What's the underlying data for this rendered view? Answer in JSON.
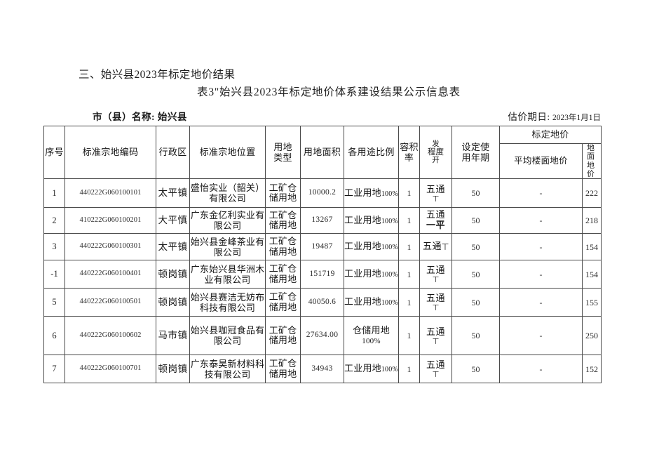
{
  "document": {
    "section_heading": "三、始兴县2023年标定地价结果",
    "title": "表3\"始兴县2023年标定地价体系建设结果公示信息表",
    "meta": {
      "city_label": "市（县）名称:",
      "city_value": "始兴县",
      "valuation_label": "估价期日:",
      "valuation_value": "2023年1月1日"
    }
  },
  "table": {
    "headers": {
      "seq": "序号",
      "code": "标准宗地编码",
      "district": "行政区",
      "location": "标准宗地位置",
      "landtype_l1": "用地",
      "landtype_l2": "类型",
      "area": "用地面积",
      "usage": "各用途比例",
      "far": "容积率",
      "dev_l1": "发",
      "dev_l2": "程度",
      "dev_l3": "开",
      "term_l1": "设定使",
      "term_l2": "用年期",
      "price_group": "标定地价",
      "floor_price": "平均楼面地价",
      "ground_price_l1": "地 面",
      "ground_price_l2": "地 价"
    },
    "rows": [
      {
        "seq": "1",
        "code": "440222G060100101",
        "district": "太平镇",
        "location": "盛怡实业（韶关）有限公司",
        "landtype_l1": "工矿仓",
        "landtype_l2": "储用地",
        "area": "10000.2",
        "usage_name": "工业用地",
        "usage_pct": "100%",
        "usage_two_line": false,
        "far": "1",
        "dev_main": "五通",
        "dev_sub": "丅",
        "dev_style": "stacked",
        "term": "50",
        "floor_price": "-",
        "ground_price": "222"
      },
      {
        "seq": "2",
        "code": "410222G060100201",
        "district": "大平慎",
        "location": "广东金亿利实业有限公司",
        "landtype_l1": "工矿仓",
        "landtype_l2": "储用地",
        "area": "13267",
        "usage_name": "工业用地",
        "usage_pct": "100%",
        "usage_two_line": false,
        "far": "1",
        "dev_main": "五通",
        "dev_sub": "一平",
        "dev_style": "twofull",
        "term": "50",
        "floor_price": "-",
        "ground_price": "218"
      },
      {
        "seq": "3",
        "code": "440222G060100301",
        "district": "太平镇",
        "location": "始兴县金峰茶业有限公司",
        "landtype_l1": "工矿仓",
        "landtype_l2": "储用地",
        "area": "19487",
        "usage_name": "工业用地",
        "usage_pct": "100%",
        "usage_two_line": false,
        "far": "1",
        "dev_main": "五通",
        "dev_sub": "丅",
        "dev_style": "inline",
        "term": "50",
        "floor_price": "-",
        "ground_price": "154"
      },
      {
        "seq": "-1",
        "code": "440222G060100401",
        "district": "顿岗镇",
        "location": "广东始兴县华洲木业有限公司",
        "landtype_l1": "工矿仓",
        "landtype_l2": "储用地",
        "area": "151719",
        "usage_name": "工业用地",
        "usage_pct": "100%",
        "usage_two_line": false,
        "far": "1",
        "dev_main": "五通",
        "dev_sub": "丅",
        "dev_style": "stacked",
        "term": "50",
        "floor_price": "-",
        "ground_price": "154"
      },
      {
        "seq": "5",
        "code": "440222G060100501",
        "district": "顿岗镇",
        "location": "始兴县赛洁无妨布科技有限公司",
        "landtype_l1": "工矿仓",
        "landtype_l2": "储用地",
        "area": "40050.6",
        "usage_name": "工业用地",
        "usage_pct": "100%",
        "usage_two_line": false,
        "far": "1",
        "dev_main": "五通",
        "dev_sub": "丅",
        "dev_style": "stacked",
        "term": "50",
        "floor_price": "-",
        "ground_price": "155"
      },
      {
        "seq": "6",
        "code": "440222G060100602",
        "district": "马市镇",
        "location": "始兴县咖冠食品有限公司",
        "landtype_l1": "工矿仓",
        "landtype_l2": "储用地",
        "area": "27634.00",
        "usage_name": "仓储用地",
        "usage_pct": "100%",
        "usage_two_line": true,
        "far": "1",
        "dev_main": "五通",
        "dev_sub": "丅",
        "dev_style": "stacked",
        "term": "50",
        "floor_price": "-",
        "ground_price": "250"
      },
      {
        "seq": "7",
        "code": "440222G060100701",
        "district": "顿岗镇",
        "location": "广东泰昊新材料科技有限公司",
        "landtype_l1": "工矿仓",
        "landtype_l2": "储用地",
        "area": "34943",
        "usage_name": "工业用地",
        "usage_pct": "100%",
        "usage_two_line": false,
        "far": "1",
        "dev_main": "五通",
        "dev_sub": "丅",
        "dev_style": "stacked",
        "term": "50",
        "floor_price": "-",
        "ground_price": "152"
      }
    ]
  }
}
